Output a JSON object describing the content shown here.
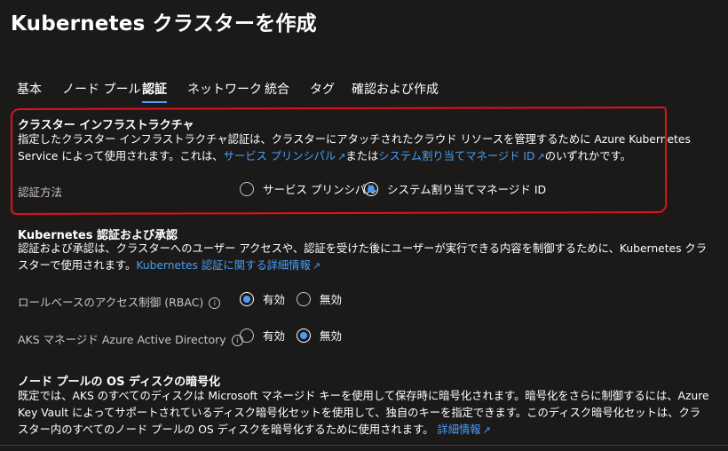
{
  "header": {
    "title": "Kubernetes クラスターを作成",
    "more": "…"
  },
  "tabs": [
    {
      "label": "基本"
    },
    {
      "label": "ノード プール"
    },
    {
      "label": "認証"
    },
    {
      "label": "ネットワーク"
    },
    {
      "label": "統合"
    },
    {
      "label": "タグ"
    },
    {
      "label": "確認および作成"
    }
  ],
  "infra": {
    "title": "クラスター インフラストラクチャ",
    "desc_1": "指定したクラスター インフラストラクチャ認証は、クラスターにアタッチされたクラウド リソースを管理するために Azure Kubernetes Service によって使用されます。これは、",
    "link_sp": "サービス プリンシパル",
    "desc_2": "または",
    "link_mi": "システム割り当てマネージド ID",
    "desc_3": "のいずれかです。",
    "auth_label": "認証方法",
    "opt_sp": "サービス プリンシパル",
    "opt_mi": "システム割り当てマネージド ID"
  },
  "k8s_auth": {
    "title": "Kubernetes 認証および承認",
    "desc": "認証および承認は、クラスターへのユーザー アクセスや、認証を受けた後にユーザーが実行できる内容を制御するために、Kubernetes クラスターで使用されます。",
    "link": "Kubernetes 認証に関する詳細情報",
    "rbac_label": "ロールベースのアクセス制御 (RBAC)",
    "aad_label": "AKS マネージド Azure Active Directory",
    "enabled": "有効",
    "disabled": "無効",
    "info_glyph": "i"
  },
  "encryption": {
    "title": "ノード プールの OS ディスクの暗号化",
    "desc": "既定では、AKS のすべてのディスクは Microsoft マネージド キーを使用して保存時に暗号化されます。暗号化をさらに制御するには、Azure Key Vault によってサポートされているディスク暗号化セットを使用して、独自のキーを指定できます。このディスク暗号化セットは、クラスター内のすべてのノード プールの OS ディスクを暗号化するために使用されます。",
    "link": "詳細情報"
  },
  "state": {
    "active_tab": "認証",
    "auth_method": "システム割り当てマネージド ID",
    "rbac": "有効",
    "aad": "無効"
  },
  "colors": {
    "background": "#1b1a19",
    "accent": "#479ef5",
    "annotation": "#e3101f",
    "muted_text": "#c8c6c4"
  },
  "icons": {
    "external": "↗"
  }
}
